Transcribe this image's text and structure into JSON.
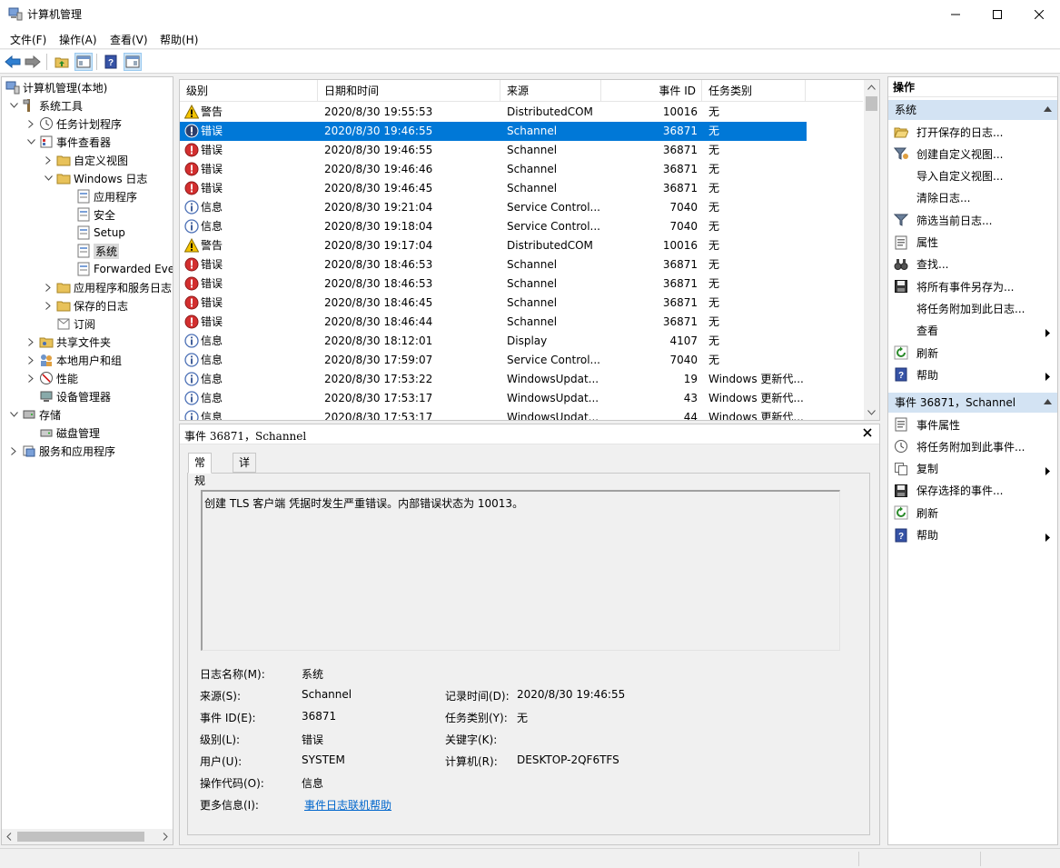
{
  "window": {
    "title": "计算机管理",
    "minimize": "minimize-icon",
    "maximize": "maximize-icon",
    "close": "close-icon"
  },
  "menu": [
    "文件(F)",
    "操作(A)",
    "查看(V)",
    "帮助(H)"
  ],
  "tree": [
    {
      "label": "计算机管理(本地)",
      "icon": "computer-management-icon"
    },
    {
      "label": "系统工具",
      "icon": "tools-icon"
    },
    {
      "label": "任务计划程序",
      "icon": "clock-icon"
    },
    {
      "label": "事件查看器",
      "icon": "event-viewer-icon"
    },
    {
      "label": "自定义视图",
      "icon": "folder-icon"
    },
    {
      "label": "Windows 日志",
      "icon": "folder-icon"
    },
    {
      "label": "应用程序",
      "icon": "log-icon"
    },
    {
      "label": "安全",
      "icon": "log-icon"
    },
    {
      "label": "Setup",
      "icon": "log-icon"
    },
    {
      "label": "系统",
      "icon": "log-icon"
    },
    {
      "label": "Forwarded Eve",
      "icon": "log-icon"
    },
    {
      "label": "应用程序和服务日志",
      "icon": "folder-icon"
    },
    {
      "label": "保存的日志",
      "icon": "folder-icon"
    },
    {
      "label": "订阅",
      "icon": "subscription-icon"
    },
    {
      "label": "共享文件夹",
      "icon": "shared-folder-icon"
    },
    {
      "label": "本地用户和组",
      "icon": "users-icon"
    },
    {
      "label": "性能",
      "icon": "performance-icon"
    },
    {
      "label": "设备管理器",
      "icon": "device-manager-icon"
    },
    {
      "label": "存储",
      "icon": "storage-icon"
    },
    {
      "label": "磁盘管理",
      "icon": "disk-icon"
    },
    {
      "label": "服务和应用程序",
      "icon": "services-icon"
    }
  ],
  "list": {
    "columns": [
      "级别",
      "日期和时间",
      "来源",
      "事件 ID",
      "任务类别"
    ],
    "rows": [
      {
        "level": "警告",
        "type": "warning",
        "datetime": "2020/8/30 19:55:53",
        "source": "DistributedCOM",
        "id": "10016",
        "category": "无"
      },
      {
        "level": "错误",
        "type": "error",
        "datetime": "2020/8/30 19:46:55",
        "source": "Schannel",
        "id": "36871",
        "category": "无"
      },
      {
        "level": "错误",
        "type": "error",
        "datetime": "2020/8/30 19:46:55",
        "source": "Schannel",
        "id": "36871",
        "category": "无"
      },
      {
        "level": "错误",
        "type": "error",
        "datetime": "2020/8/30 19:46:46",
        "source": "Schannel",
        "id": "36871",
        "category": "无"
      },
      {
        "level": "错误",
        "type": "error",
        "datetime": "2020/8/30 19:46:45",
        "source": "Schannel",
        "id": "36871",
        "category": "无"
      },
      {
        "level": "信息",
        "type": "info",
        "datetime": "2020/8/30 19:21:04",
        "source": "Service Control...",
        "id": "7040",
        "category": "无"
      },
      {
        "level": "信息",
        "type": "info",
        "datetime": "2020/8/30 19:18:04",
        "source": "Service Control...",
        "id": "7040",
        "category": "无"
      },
      {
        "level": "警告",
        "type": "warning",
        "datetime": "2020/8/30 19:17:04",
        "source": "DistributedCOM",
        "id": "10016",
        "category": "无"
      },
      {
        "level": "错误",
        "type": "error",
        "datetime": "2020/8/30 18:46:53",
        "source": "Schannel",
        "id": "36871",
        "category": "无"
      },
      {
        "level": "错误",
        "type": "error",
        "datetime": "2020/8/30 18:46:53",
        "source": "Schannel",
        "id": "36871",
        "category": "无"
      },
      {
        "level": "错误",
        "type": "error",
        "datetime": "2020/8/30 18:46:45",
        "source": "Schannel",
        "id": "36871",
        "category": "无"
      },
      {
        "level": "错误",
        "type": "error",
        "datetime": "2020/8/30 18:46:44",
        "source": "Schannel",
        "id": "36871",
        "category": "无"
      },
      {
        "level": "信息",
        "type": "info",
        "datetime": "2020/8/30 18:12:01",
        "source": "Display",
        "id": "4107",
        "category": "无"
      },
      {
        "level": "信息",
        "type": "info",
        "datetime": "2020/8/30 17:59:07",
        "source": "Service Control...",
        "id": "7040",
        "category": "无"
      },
      {
        "level": "信息",
        "type": "info",
        "datetime": "2020/8/30 17:53:22",
        "source": "WindowsUpdat...",
        "id": "19",
        "category": "Windows 更新代..."
      },
      {
        "level": "信息",
        "type": "info",
        "datetime": "2020/8/30 17:53:17",
        "source": "WindowsUpdat...",
        "id": "43",
        "category": "Windows 更新代..."
      },
      {
        "level": "信息",
        "type": "info",
        "datetime": "2020/8/30 17:53:17",
        "source": "WindowsUpdat...",
        "id": "44",
        "category": "Windows 更新代..."
      }
    ]
  },
  "detail": {
    "title": "事件 36871，Schannel",
    "tabs": [
      "常规",
      "详细信息"
    ],
    "description": "创建 TLS 客户端 凭据时发生严重错误。内部错误状态为 10013。",
    "fields": {
      "log_name_label": "日志名称(M):",
      "log_name": "系统",
      "source_label": "来源(S):",
      "source": "Schannel",
      "logged_label": "记录时间(D):",
      "logged": "2020/8/30 19:46:55",
      "event_id_label": "事件 ID(E):",
      "event_id": "36871",
      "task_label": "任务类别(Y):",
      "task": "无",
      "level_label": "级别(L):",
      "level": "错误",
      "keywords_label": "关键字(K):",
      "keywords": "",
      "user_label": "用户(U):",
      "user": "SYSTEM",
      "computer_label": "计算机(R):",
      "computer": "DESKTOP-2QF6TFS",
      "opcode_label": "操作代码(O):",
      "opcode": "信息",
      "more_label": "更多信息(I):",
      "more_link": "事件日志联机帮助"
    }
  },
  "actions": {
    "title": "操作",
    "section1": "系统",
    "items1": [
      {
        "label": "打开保存的日志...",
        "icon": "open-folder-icon"
      },
      {
        "label": "创建自定义视图...",
        "icon": "filter-add-icon"
      },
      {
        "label": "导入自定义视图...",
        "icon": ""
      },
      {
        "label": "清除日志...",
        "icon": ""
      },
      {
        "label": "筛选当前日志...",
        "icon": "filter-icon"
      },
      {
        "label": "属性",
        "icon": "properties-icon"
      },
      {
        "label": "查找...",
        "icon": "binoculars-icon"
      },
      {
        "label": "将所有事件另存为...",
        "icon": "save-icon"
      },
      {
        "label": "将任务附加到此日志...",
        "icon": ""
      },
      {
        "label": "查看",
        "icon": ""
      },
      {
        "label": "刷新",
        "icon": "refresh-icon"
      },
      {
        "label": "帮助",
        "icon": "help-icon"
      }
    ],
    "section2": "事件 36871，Schannel",
    "items2": [
      {
        "label": "事件属性",
        "icon": "properties-icon"
      },
      {
        "label": "将任务附加到此事件...",
        "icon": "clock-icon"
      },
      {
        "label": "复制",
        "icon": "copy-icon"
      },
      {
        "label": "保存选择的事件...",
        "icon": "save-icon"
      },
      {
        "label": "刷新",
        "icon": "refresh-icon"
      },
      {
        "label": "帮助",
        "icon": "help-icon"
      }
    ]
  },
  "colors": {
    "selection": "#0078d7",
    "section_header": "#d3e3f3",
    "link": "#0066cc",
    "error": "#d32f2f",
    "warning": "#f5c400",
    "info": "#4a6fb5"
  }
}
